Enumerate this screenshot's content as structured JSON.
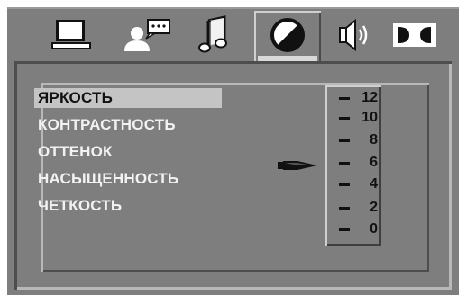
{
  "tabs": [
    {
      "icon": "monitor-icon",
      "active": false
    },
    {
      "icon": "user-speech-icon",
      "active": false
    },
    {
      "icon": "music-note-icon",
      "active": false
    },
    {
      "icon": "contrast-circle-icon",
      "active": true
    },
    {
      "icon": "speaker-icon",
      "active": false
    },
    {
      "icon": "dolby-icon",
      "active": false
    }
  ],
  "menu": {
    "items": [
      {
        "label": "ЯРКОСТЬ",
        "selected": true
      },
      {
        "label": "КОНТРАСТНОСТЬ",
        "selected": false
      },
      {
        "label": "ОТТЕНОК",
        "selected": false
      },
      {
        "label": "НАСЫЩЕННОСТЬ",
        "selected": false
      },
      {
        "label": "ЧЕТКОСТЬ",
        "selected": false
      }
    ]
  },
  "scale": {
    "values": [
      "12",
      "10",
      "8",
      "6",
      "4",
      "2",
      "0"
    ],
    "current": "6"
  },
  "colors": {
    "background": "#7e7e7e",
    "highlight": "#c4c4c4",
    "text": "#f2f2f2"
  }
}
